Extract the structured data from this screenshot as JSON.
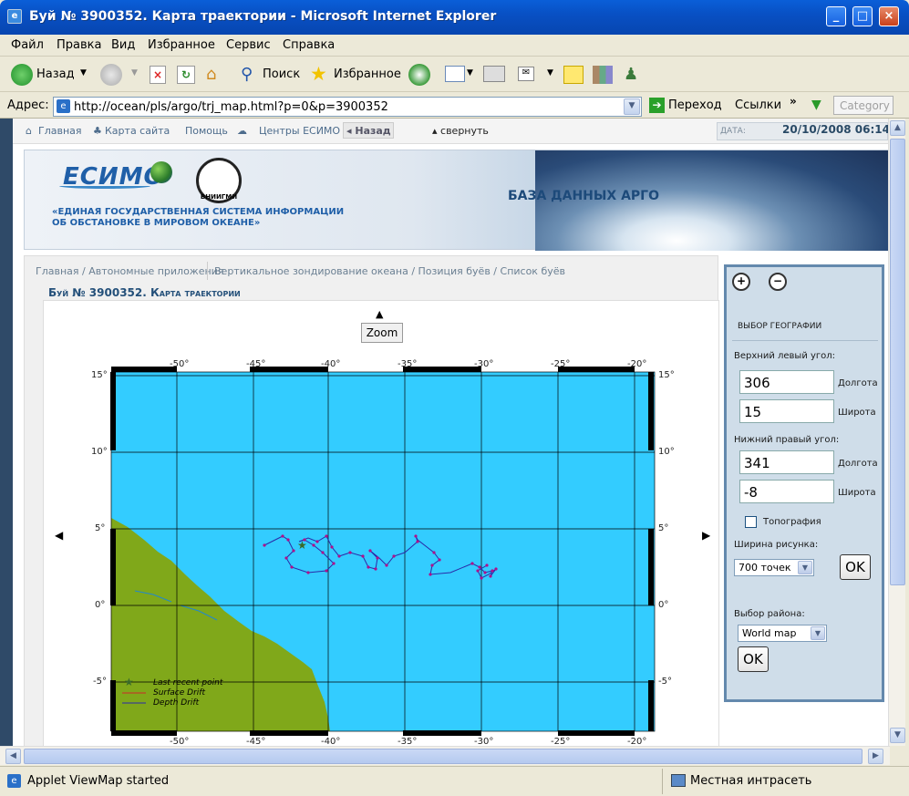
{
  "window": {
    "title": "Буй № 3900352. Карта траектории - Microsoft Internet Explorer",
    "buttons": [
      "_",
      "□",
      "×"
    ]
  },
  "menu": [
    "Файл",
    "Правка",
    "Вид",
    "Избранное",
    "Сервис",
    "Справка"
  ],
  "toolbar": {
    "back_label": "Назад",
    "search_label": "Поиск",
    "favorites_label": "Избранное"
  },
  "address": {
    "label": "Адрес:",
    "url": "http://ocean/pls/argo/trj_map.html?p=0&p=3900352",
    "go_label": "Переход",
    "links_label": "Ссылки",
    "category_label": "Category"
  },
  "nav": {
    "links": [
      "Главная",
      "Карта сайта",
      "Помощь",
      "Центры ЕСИМО",
      "Назад"
    ],
    "collapse_label": "свернуть",
    "date_label": "ДАТА:",
    "date_value": "20/10/2008 06:14"
  },
  "banner": {
    "logo_text": "ЕСИМО",
    "tagline_1": "«ЕДИНАЯ ГОСУДАРСТВЕННАЯ СИСТЕМА ИНФОРМАЦИИ",
    "tagline_2": "ОБ ОБСТАНОВКЕ В МИРОВОМ ОКЕАНЕ»",
    "emblem_text": "ВНИИГМИ",
    "database_title": "БАЗА ДАННЫХ АРГО"
  },
  "breadcrumb": {
    "part1": "Главная / Автономные приложения",
    "part2": "Вертикальное зондирование океана / Позиция буёв / Список буёв"
  },
  "page_title": "Буй № 3900352. Карта траектории",
  "map": {
    "zoom_label": "Zoom",
    "lon_labels": [
      "-50°",
      "-45°",
      "-40°",
      "-35°",
      "-30°",
      "-25°",
      "-20°"
    ],
    "lat_labels": [
      "15°",
      "10°",
      "5°",
      "0°",
      "-5°"
    ],
    "legend": [
      "Last recent point",
      "Surface Drift",
      "Depth Drift"
    ],
    "ocean_color": "#33ccff",
    "land_color": "#80a81a",
    "track_color": "#2a2aa8",
    "point_color": "#b0108a"
  },
  "sidebar": {
    "section_title": "ВЫБОР ГЕОГРАФИИ",
    "upper_left_label": "Верхний левый угол:",
    "upper_left_lon": "306",
    "upper_left_lat": "15",
    "lower_right_label": "Нижний правый угол:",
    "lower_right_lon": "341",
    "lower_right_lat": "-8",
    "lon_label": "Долгота",
    "lat_label": "Широта",
    "topography_label": "Топография",
    "width_label": "Ширина рисунка:",
    "width_value": "700 точек",
    "ok_label": "OK",
    "region_label": "Выбор района:",
    "region_value": "World map"
  },
  "status": {
    "message": "Applet ViewMap started",
    "zone": "Местная интрасеть"
  }
}
